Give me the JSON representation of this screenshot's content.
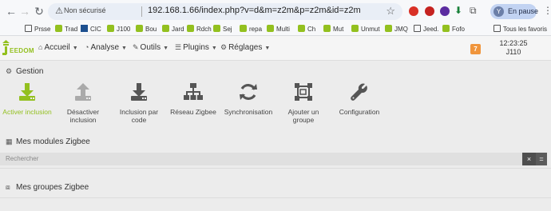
{
  "browser": {
    "back_icon": "←",
    "forward_icon": "→",
    "reload_icon": "↻",
    "security_icon": "⚠",
    "security_label": "Non sécurisé",
    "url": "192.168.1.66/index.php?v=d&m=z2m&p=z2m&id=z2m",
    "star_icon": "☆",
    "profile_initial": "Y",
    "profile_status": "En pause",
    "menu_icon": "⋮"
  },
  "bookmarks": {
    "items": [
      {
        "label": "Prsse",
        "icon": "folder"
      },
      {
        "label": "Trad",
        "icon": "jeedom"
      },
      {
        "label": "CIC",
        "icon": "bank"
      },
      {
        "label": "J100",
        "icon": "jeedom"
      },
      {
        "label": "Bou",
        "icon": "jeedom"
      },
      {
        "label": "Jard",
        "icon": "jeedom"
      },
      {
        "label": "Rdch",
        "icon": "jeedom"
      },
      {
        "label": "Sej",
        "icon": "jeedom"
      },
      {
        "label": "repa",
        "icon": "jeedom"
      },
      {
        "label": "Multi",
        "icon": "jeedom"
      },
      {
        "label": "Ch",
        "icon": "jeedom"
      },
      {
        "label": "Mut",
        "icon": "jeedom"
      },
      {
        "label": "Unmut",
        "icon": "jeedom"
      },
      {
        "label": "JMQ",
        "icon": "jeedom"
      },
      {
        "label": "Jeed.",
        "icon": "folder"
      },
      {
        "label": "Fofo",
        "icon": "jeedom"
      }
    ],
    "all_bookmarks": "Tous les favoris"
  },
  "navbar": {
    "logo_text": "EEDOM",
    "menus": [
      {
        "label": "Accueil",
        "icon": "home-icon"
      },
      {
        "label": "Analyse",
        "icon": "tachometer-icon"
      },
      {
        "label": "Outils",
        "icon": "wrench-icon"
      },
      {
        "label": "Plugins",
        "icon": "tasks-icon"
      },
      {
        "label": "Réglages",
        "icon": "cogs-icon"
      }
    ],
    "notification_count": "7",
    "time": "12:23:25",
    "host": "J110"
  },
  "gestion": {
    "title": "Gestion",
    "tiles": [
      {
        "label": "Activer inclusion",
        "icon": "download-icon",
        "active": true
      },
      {
        "label": "Désactiver inclusion",
        "icon": "upload-icon",
        "active": false
      },
      {
        "label": "Inclusion par code",
        "icon": "download-icon",
        "active": false
      },
      {
        "label": "Réseau Zigbee",
        "icon": "sitemap-icon",
        "active": false
      },
      {
        "label": "Synchronisation",
        "icon": "sync-icon",
        "active": false
      },
      {
        "label": "Ajouter un groupe",
        "icon": "group-icon",
        "active": false
      },
      {
        "label": "Configuration",
        "icon": "wrench-icon",
        "active": false
      }
    ]
  },
  "modules": {
    "title": "Mes modules Zigbee",
    "search_placeholder": "Rechercher",
    "reset_icon": "×",
    "toggle_icon": "="
  },
  "groups": {
    "title": "Mes groupes Zigbee"
  },
  "colors": {
    "accent": "#93c01f",
    "badge": "#f0953c",
    "icon_gray": "#555555"
  }
}
